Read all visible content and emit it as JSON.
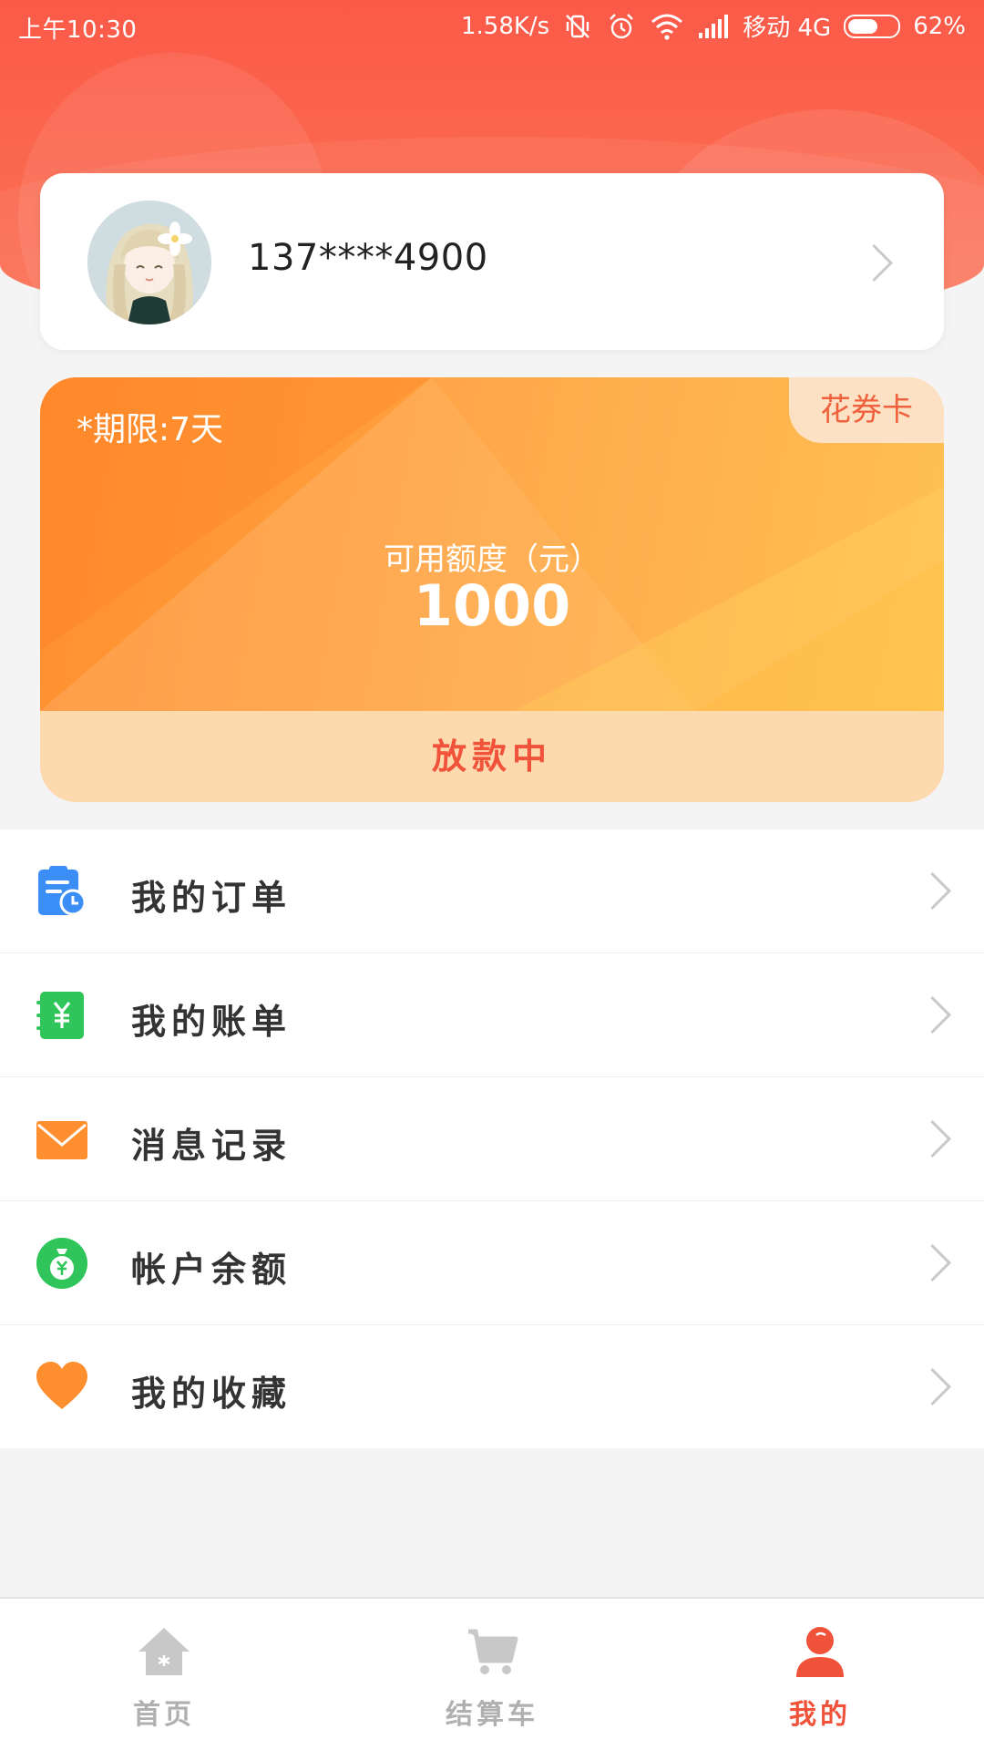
{
  "status_bar": {
    "time": "上午10:30",
    "net_speed": "1.58K/s",
    "carrier": "移动 4G",
    "battery": "62%",
    "battery_level": 0.62
  },
  "profile": {
    "phone": "137****4900",
    "avatar_icon": "avatar-girl-icon"
  },
  "credit_card": {
    "term": "*期限:7天",
    "badge": "花券卡",
    "label": "可用额度（元）",
    "amount": "1000",
    "status": "放款中"
  },
  "menu": {
    "items": [
      {
        "label": "我的订单",
        "icon": "order-clipboard-icon",
        "color": "#3a8ef6"
      },
      {
        "label": "我的账单",
        "icon": "bill-yuan-icon",
        "color": "#2fc55a"
      },
      {
        "label": "消息记录",
        "icon": "envelope-icon",
        "color": "#ff8f2e"
      },
      {
        "label": "帐户余额",
        "icon": "money-bag-icon",
        "color": "#2fc55a"
      },
      {
        "label": "我的收藏",
        "icon": "heart-icon",
        "color": "#ff8f2e"
      }
    ]
  },
  "tabbar": {
    "tabs": [
      {
        "label": "首页",
        "icon": "home-icon",
        "active": false
      },
      {
        "label": "结算车",
        "icon": "cart-icon",
        "active": false
      },
      {
        "label": "我的",
        "icon": "user-icon",
        "active": true
      }
    ]
  },
  "colors": {
    "header": "#fb5a48",
    "accent": "#f0523a",
    "card_orange": "#ff9a3a"
  }
}
